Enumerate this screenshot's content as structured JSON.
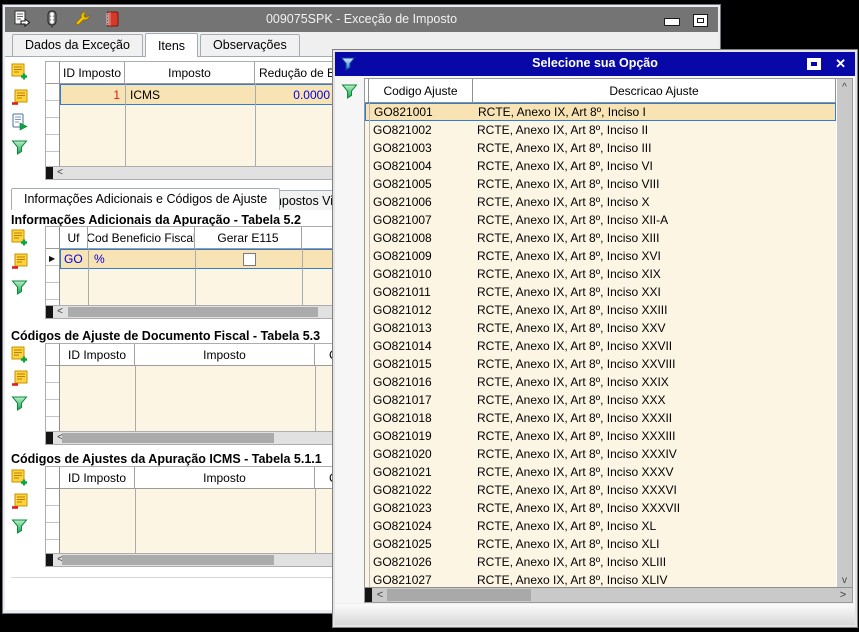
{
  "main_window": {
    "title": "009075SPK - Exceção de Imposto",
    "tabs": {
      "items": [
        "Dados da Exceção",
        "Itens",
        "Observações"
      ],
      "active": "Itens"
    },
    "grid_itens": {
      "columns": [
        "ID Imposto",
        "Imposto",
        "Redução de Ba"
      ],
      "row": {
        "id_imposto": "1",
        "imposto": "ICMS",
        "reducao_base": "0.0000"
      }
    },
    "inner_tabs": {
      "items": [
        "Informações Adicionais e Códigos de Ajuste",
        "Impostos Vinculad"
      ],
      "active": "Informações Adicionais e Códigos de Ajuste"
    },
    "section_apuracao": {
      "title": "Informações Adicionais da Apuração - Tabela 5.2",
      "columns": [
        "Uf",
        "Cod Beneficio Fiscal",
        "Gerar E115"
      ],
      "row": {
        "uf": "GO",
        "cod_beneficio": "%",
        "gerar_e115_checked": false
      }
    },
    "section_doc_fiscal": {
      "title": "Códigos de Ajuste de Documento Fiscal - Tabela 5.3",
      "columns": [
        "ID Imposto",
        "Imposto",
        "C"
      ]
    },
    "section_apuracao_icms": {
      "title": "Códigos de Ajustes da Apuração ICMS - Tabela 5.1.1",
      "columns": [
        "ID Imposto",
        "Imposto",
        "C"
      ]
    }
  },
  "popup": {
    "title": "Selecione sua Opção",
    "columns": [
      "Codigo Ajuste",
      "Descricao Ajuste"
    ],
    "selected_index": 0,
    "rows": [
      [
        "GO821001",
        "RCTE, Anexo IX, Art 8º, Inciso I"
      ],
      [
        "GO821002",
        "RCTE, Anexo IX, Art 8º, Inciso II"
      ],
      [
        "GO821003",
        "RCTE, Anexo IX, Art 8º, Inciso III"
      ],
      [
        "GO821004",
        "RCTE, Anexo IX, Art 8º, Inciso VI"
      ],
      [
        "GO821005",
        "RCTE, Anexo IX, Art 8º, Inciso VIII"
      ],
      [
        "GO821006",
        "RCTE, Anexo IX, Art 8º, Inciso X"
      ],
      [
        "GO821007",
        "RCTE, Anexo IX, Art 8º, Inciso XII-A"
      ],
      [
        "GO821008",
        "RCTE, Anexo IX, Art 8º, Inciso XIII"
      ],
      [
        "GO821009",
        "RCTE, Anexo IX, Art 8º, Inciso XVI"
      ],
      [
        "GO821010",
        "RCTE, Anexo IX, Art 8º, Inciso XIX"
      ],
      [
        "GO821011",
        "RCTE, Anexo IX, Art 8º, Inciso XXI"
      ],
      [
        "GO821012",
        "RCTE, Anexo IX, Art 8º, Inciso XXIII"
      ],
      [
        "GO821013",
        "RCTE, Anexo IX, Art 8º, Inciso XXV"
      ],
      [
        "GO821014",
        "RCTE, Anexo IX, Art 8º, Inciso XXVII"
      ],
      [
        "GO821015",
        "RCTE, Anexo IX, Art 8º, Inciso XXVIII"
      ],
      [
        "GO821016",
        "RCTE, Anexo IX, Art 8º, Inciso XXIX"
      ],
      [
        "GO821017",
        "RCTE, Anexo IX, Art 8º, Inciso XXX"
      ],
      [
        "GO821018",
        "RCTE, Anexo IX, Art 8º, Inciso XXXII"
      ],
      [
        "GO821019",
        "RCTE, Anexo IX, Art 8º, Inciso XXXIII"
      ],
      [
        "GO821020",
        "RCTE, Anexo IX, Art 8º, Inciso XXXIV"
      ],
      [
        "GO821021",
        "RCTE, Anexo IX, Art 8º, Inciso XXXV"
      ],
      [
        "GO821022",
        "RCTE, Anexo IX, Art 8º, Inciso XXXVI"
      ],
      [
        "GO821023",
        "RCTE, Anexo IX, Art 8º, Inciso XXXVII"
      ],
      [
        "GO821024",
        "RCTE, Anexo IX, Art 8º, Inciso XL"
      ],
      [
        "GO821025",
        "RCTE, Anexo IX, Art 8º, Inciso XLI"
      ],
      [
        "GO821026",
        "RCTE, Anexo IX, Art 8º, Inciso XLIII"
      ],
      [
        "GO821027",
        "RCTE, Anexo IX, Art 8º, Inciso XLIV"
      ]
    ]
  },
  "icons": {
    "scroll_left": "<",
    "scroll_right": ">",
    "scroll_up": "^",
    "scroll_down": "v",
    "row_indicator": "▶",
    "close_glyph": "✕"
  },
  "colors": {
    "titlebar_main": "#747474",
    "titlebar_popup": "#0808A8",
    "row_cream": "#FCF5E4",
    "row_selected": "#F8E3B4",
    "sel_border": "#2F7CD0",
    "val_blue": "#0000E0",
    "val_red": "#E01818"
  }
}
